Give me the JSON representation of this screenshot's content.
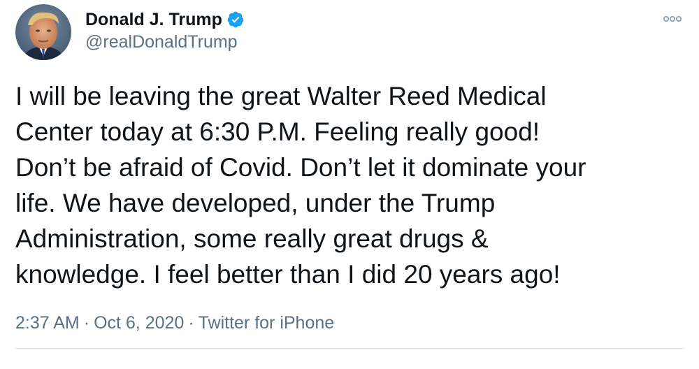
{
  "author": {
    "name": "Donald J. Trump",
    "handle": "@realDonaldTrump",
    "verified": true,
    "avatar_icon": "profile-photo"
  },
  "tweet": {
    "text": "I will be leaving the great Walter Reed Medical\nCenter today at 6:30 P.M. Feeling really good!\nDon’t be afraid of Covid. Don’t let it dominate your\nlife. We have developed, under the Trump\nAdministration, some really great drugs &\nknowledge. I feel better than I did 20 years ago!",
    "time": "2:37 AM",
    "date": "Oct 6, 2020",
    "source": "Twitter for iPhone",
    "separator": "·"
  },
  "icons": {
    "verified": "verified-badge-icon",
    "more": "more-options-icon"
  },
  "colors": {
    "text": "#0f1419",
    "secondary": "#5b7083",
    "verified": "#1da1f2",
    "divider": "#e1e8ed"
  }
}
